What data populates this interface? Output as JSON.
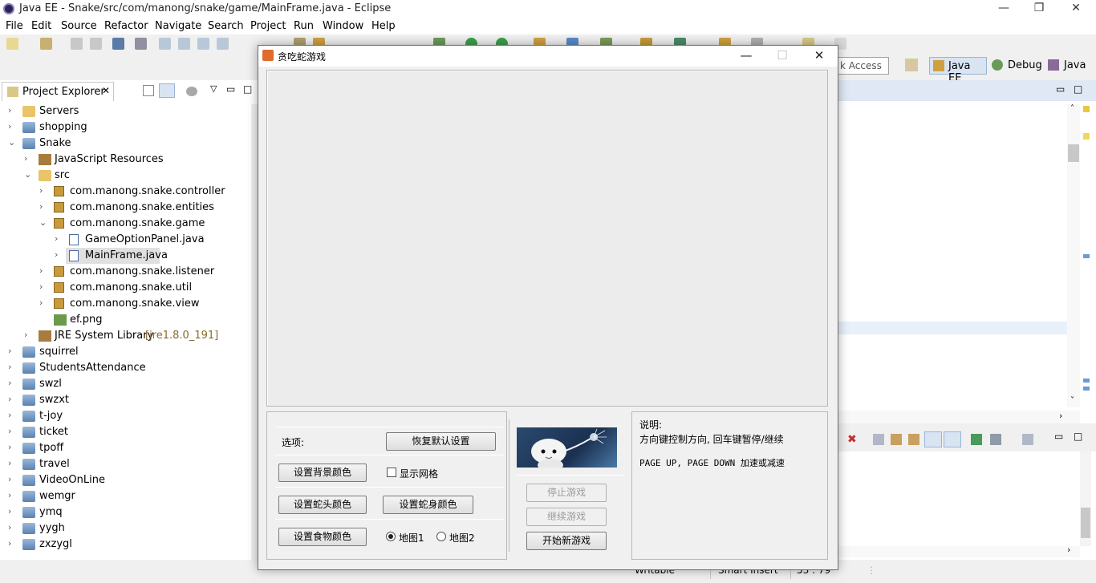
{
  "eclipse": {
    "title": "Java EE - Snake/src/com/manong/snake/game/MainFrame.java - Eclipse",
    "menu": [
      "File",
      "Edit",
      "Source",
      "Refactor",
      "Navigate",
      "Search",
      "Project",
      "Run",
      "Window",
      "Help"
    ],
    "quick_access": "k Access",
    "perspectives": [
      "Java EE",
      "Debug",
      "Java"
    ],
    "status": {
      "writable": "Writable",
      "insert": "Smart Insert",
      "position": "53 : 79"
    }
  },
  "explorer": {
    "tab_label": "Project Explorer",
    "items": [
      {
        "label": "Servers",
        "icon": "folder-icon"
      },
      {
        "label": "shopping",
        "icon": "project-icon"
      },
      {
        "label": "Snake",
        "icon": "project-icon"
      },
      {
        "label": "JavaScript Resources",
        "icon": "js-resources-icon"
      },
      {
        "label": "src",
        "icon": "source-folder-icon"
      },
      {
        "label": "com.manong.snake.controller",
        "icon": "package-icon"
      },
      {
        "label": "com.manong.snake.entities",
        "icon": "package-icon"
      },
      {
        "label": "com.manong.snake.game",
        "icon": "package-icon"
      },
      {
        "label": "GameOptionPanel.java",
        "icon": "java-file-icon"
      },
      {
        "label": "MainFrame.java",
        "icon": "java-file-icon"
      },
      {
        "label": "com.manong.snake.listener",
        "icon": "package-icon"
      },
      {
        "label": "com.manong.snake.util",
        "icon": "package-icon"
      },
      {
        "label": "com.manong.snake.view",
        "icon": "package-icon"
      },
      {
        "label": "ef.png",
        "icon": "image-file-icon"
      },
      {
        "label": "JRE System Library",
        "icon": "library-icon",
        "extra": "[jre1.8.0_191]"
      },
      {
        "label": "squirrel",
        "icon": "project-icon"
      },
      {
        "label": "StudentsAttendance",
        "icon": "project-icon"
      },
      {
        "label": "swzl",
        "icon": "project-icon"
      },
      {
        "label": "swzxt",
        "icon": "project-icon"
      },
      {
        "label": "t-joy",
        "icon": "project-icon"
      },
      {
        "label": "ticket",
        "icon": "project-icon"
      },
      {
        "label": "tpoff",
        "icon": "project-icon"
      },
      {
        "label": "travel",
        "icon": "project-icon"
      },
      {
        "label": "VideoOnLine",
        "icon": "project-icon"
      },
      {
        "label": "wemgr",
        "icon": "project-icon"
      },
      {
        "label": "ymq",
        "icon": "project-icon"
      },
      {
        "label": "yygh",
        "icon": "project-icon"
      },
      {
        "label": "zxzygl",
        "icon": "project-icon"
      }
    ]
  },
  "game": {
    "title": "贪吃蛇游戏",
    "options_label": "选项:",
    "restore_defaults": "恢复默认设置",
    "bg_color": "设置背景颜色",
    "show_grid": "显示网格",
    "head_color": "设置蛇头颜色",
    "body_color": "设置蛇身颜色",
    "food_color": "设置食物颜色",
    "map1": "地图1",
    "map2": "地图2",
    "stop": "停止游戏",
    "resume": "继续游戏",
    "new_game": "开始新游戏",
    "desc_title": "说明:",
    "desc_line1": "方向键控制方向, 回车键暂停/继续",
    "desc_line2": "PAGE UP, PAGE DOWN 加速或减速",
    "show_grid_checked": false,
    "selected_map": "地图1"
  }
}
